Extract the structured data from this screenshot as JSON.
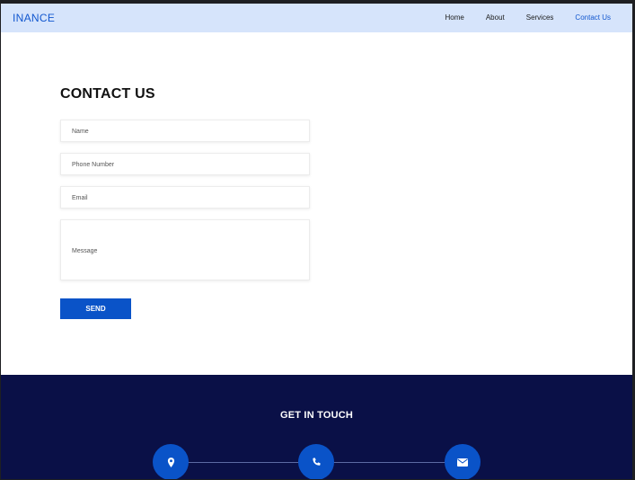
{
  "brand": "INANCE",
  "nav": {
    "items": [
      "Home",
      "About",
      "Services",
      "Contact Us"
    ],
    "active": "Contact Us"
  },
  "contact": {
    "title": "CONTACT US",
    "name_placeholder": "Name",
    "phone_placeholder": "Phone Number",
    "email_placeholder": "Email",
    "message_placeholder": "Message",
    "send_label": "SEND"
  },
  "footer": {
    "title": "GET IN TOUCH",
    "icons": [
      "location-icon",
      "phone-icon",
      "envelope-icon"
    ]
  },
  "colors": {
    "navbar_bg": "#d6e4fb",
    "accent": "#0a53c8",
    "footer_bg": "#0a1047"
  }
}
